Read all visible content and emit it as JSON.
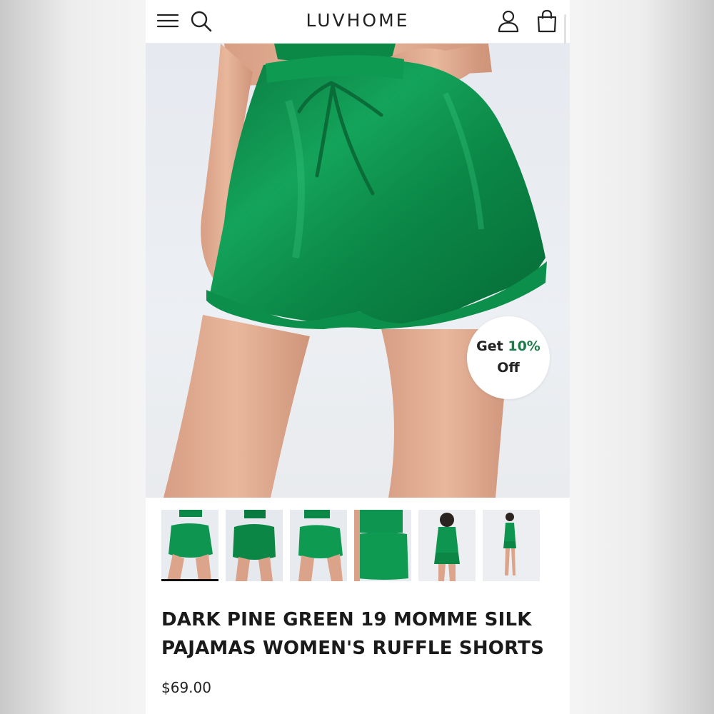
{
  "header": {
    "brand": "LUVHOME",
    "menu_icon": "menu-icon",
    "search_icon": "search-icon",
    "account_icon": "account-icon",
    "bag_icon": "shopping-bag-icon"
  },
  "promo": {
    "line1_prefix": "Get ",
    "line1_accent": "10%",
    "line2": "Off",
    "accent_color": "#1d7a4c"
  },
  "product": {
    "title": "DARK PINE GREEN 19 MOMME SILK PAJAMAS WOMEN'S RUFFLE SHORTS",
    "price": "$69.00",
    "color_swatch": "#0f8c4a"
  },
  "gallery": {
    "thumbnails_count": 6,
    "active_index": 0
  }
}
